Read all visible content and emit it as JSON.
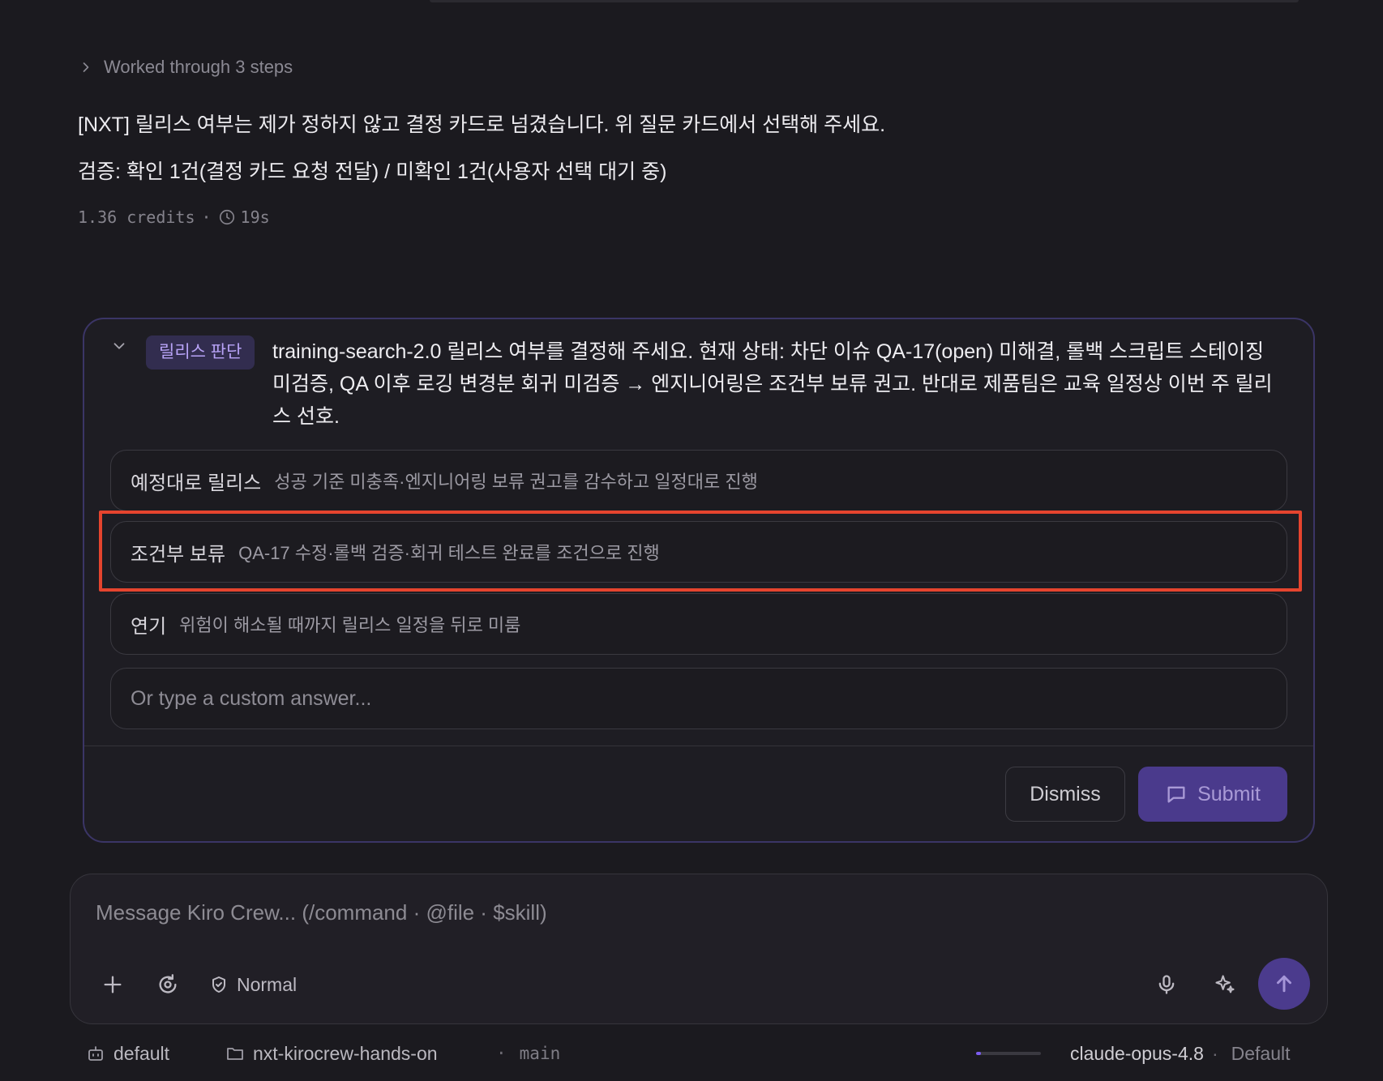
{
  "assistant": {
    "steps_label": "Worked through 3 steps",
    "message_line_1": "[NXT] 릴리스 여부는 제가 정하지 않고 결정 카드로 넘겼습니다. 위 질문 카드에서 선택해 주세요.",
    "message_line_2": "검증: 확인 1건(결정 카드 요청 전달) / 미확인 1건(사용자 선택 대기 중)",
    "credits": "1.36 credits",
    "separator": "·",
    "duration": "19s"
  },
  "decision_card": {
    "badge": "릴리스 판단",
    "question": "training-search-2.0 릴리스 여부를 결정해 주세요. 현재 상태: 차단 이슈 QA-17(open) 미해결, 롤백 스크립트 스테이징 미검증, QA 이후 로깅 변경분 회귀 미검증 → 엔지니어링은 조건부 보류 권고. 반대로 제품팀은 교육 일정상 이번 주 릴리스 선호.",
    "options": [
      {
        "label": "예정대로 릴리스",
        "description": "성공 기준 미충족·엔지니어링 보류 권고를 감수하고 일정대로 진행"
      },
      {
        "label": "조건부 보류",
        "description": "QA-17 수정·롤백 검증·회귀 테스트 완료를 조건으로 진행"
      },
      {
        "label": "연기",
        "description": "위험이 해소될 때까지 릴리스 일정을 뒤로 미룸"
      }
    ],
    "custom_placeholder": "Or type a custom answer...",
    "dismiss_label": "Dismiss",
    "submit_label": "Submit"
  },
  "composer": {
    "placeholder": "Message Kiro Crew... (/command · @file · $skill)",
    "mode_label": "Normal"
  },
  "status_bar": {
    "agent": "default",
    "repo": "nxt-kirocrew-hands-on",
    "branch_sep": "·",
    "branch": "main",
    "context_usage_fraction": 0.08,
    "model": "claude-opus-4.8",
    "model_sep": "·",
    "profile": "Default"
  },
  "colors": {
    "background": "#1b1a1f",
    "accent": "#4a3a8c",
    "badge_text": "#b8a3f7",
    "highlight": "#e5442e",
    "progress_fill": "#7c5cf0"
  },
  "icons": {
    "steps": "chevron-right-icon",
    "duration": "clock-icon",
    "collapse": "chevron-down-icon",
    "submit": "message-square-icon",
    "attach": "plus-icon",
    "history": "rotate-icon",
    "mode": "shield-check-icon",
    "voice": "microphone-icon",
    "enhance": "sparkle-icon",
    "send": "arrow-up-icon",
    "agent": "bot-icon",
    "repo": "folder-icon"
  }
}
